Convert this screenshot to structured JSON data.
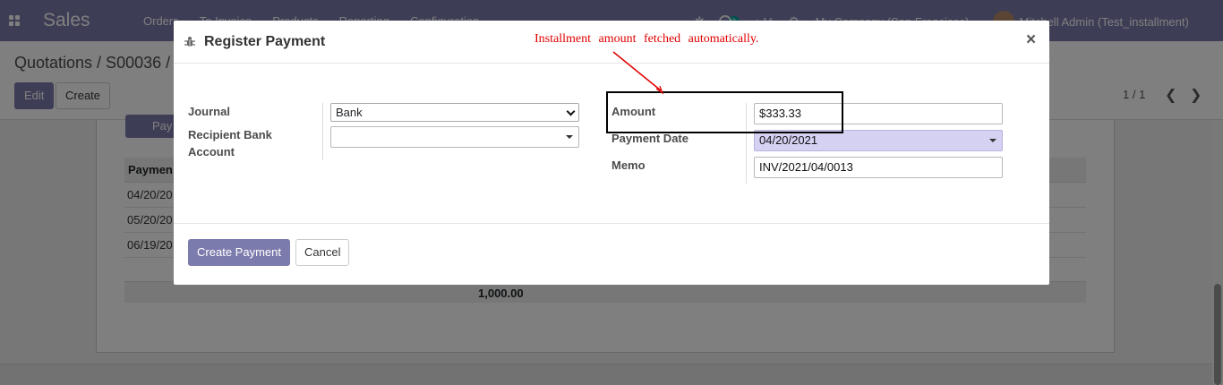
{
  "navbar": {
    "brand": "Sales",
    "menu": [
      "Orders",
      "To Invoice",
      "Products",
      "Reporting",
      "Configuration"
    ],
    "activity_count": "2",
    "message_count": "14",
    "company": "My Company (San Francisco)",
    "user": "Mitchell Admin (Test_installment)"
  },
  "control_panel": {
    "breadcrumb": "Quotations / S00036 /",
    "edit_label": "Edit",
    "create_label": "Create",
    "pager": "1 / 1"
  },
  "background_form": {
    "pay_button": "Pay",
    "table_header": "Paymen",
    "rows": [
      "04/20/20",
      "05/20/20",
      "06/19/20"
    ],
    "total": "1,000.00"
  },
  "dialog": {
    "title": "Register Payment",
    "journal_label": "Journal",
    "journal_value": "Bank",
    "recipient_label_1": "Recipient Bank",
    "recipient_label_2": "Account",
    "recipient_value": "",
    "amount_label": "Amount",
    "amount_value": "$333.33",
    "payment_date_label": "Payment Date",
    "payment_date_value": "04/20/2021",
    "memo_label": "Memo",
    "memo_value": "INV/2021/04/0013",
    "create_payment_label": "Create Payment",
    "cancel_label": "Cancel",
    "close_glyph": "×"
  },
  "annotation": {
    "text": "Installment amount fetched automatically.",
    "color": "#e00000"
  },
  "colors": {
    "primary": "#7c7bad",
    "date_field_bg": "#d5d1f2"
  }
}
